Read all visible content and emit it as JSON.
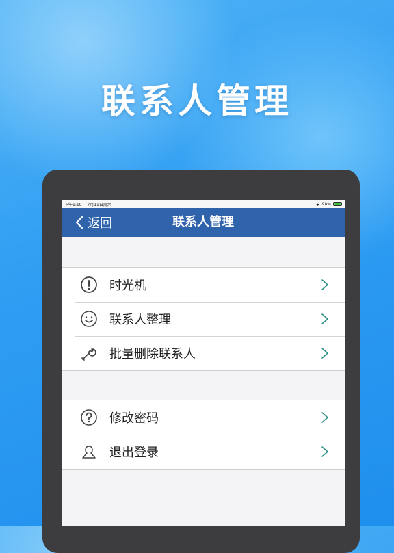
{
  "promo": {
    "title": "联系人管理"
  },
  "status_bar": {
    "time": "下午1:19",
    "date": "7月11日周六",
    "battery": "98%"
  },
  "nav": {
    "back_label": "返回",
    "title": "联系人管理"
  },
  "groups": [
    {
      "items": [
        {
          "label": "时光机",
          "icon": "exclamation-circle-icon"
        },
        {
          "label": "联系人整理",
          "icon": "smiley-face-icon"
        },
        {
          "label": "批量删除联系人",
          "icon": "wrench-icon"
        }
      ]
    },
    {
      "items": [
        {
          "label": "修改密码",
          "icon": "question-circle-icon"
        },
        {
          "label": "退出登录",
          "icon": "person-outline-icon"
        }
      ]
    }
  ],
  "colors": {
    "nav_bar": "#2f63ac",
    "chevron": "#2e8f86",
    "background": "#2f9df2"
  }
}
